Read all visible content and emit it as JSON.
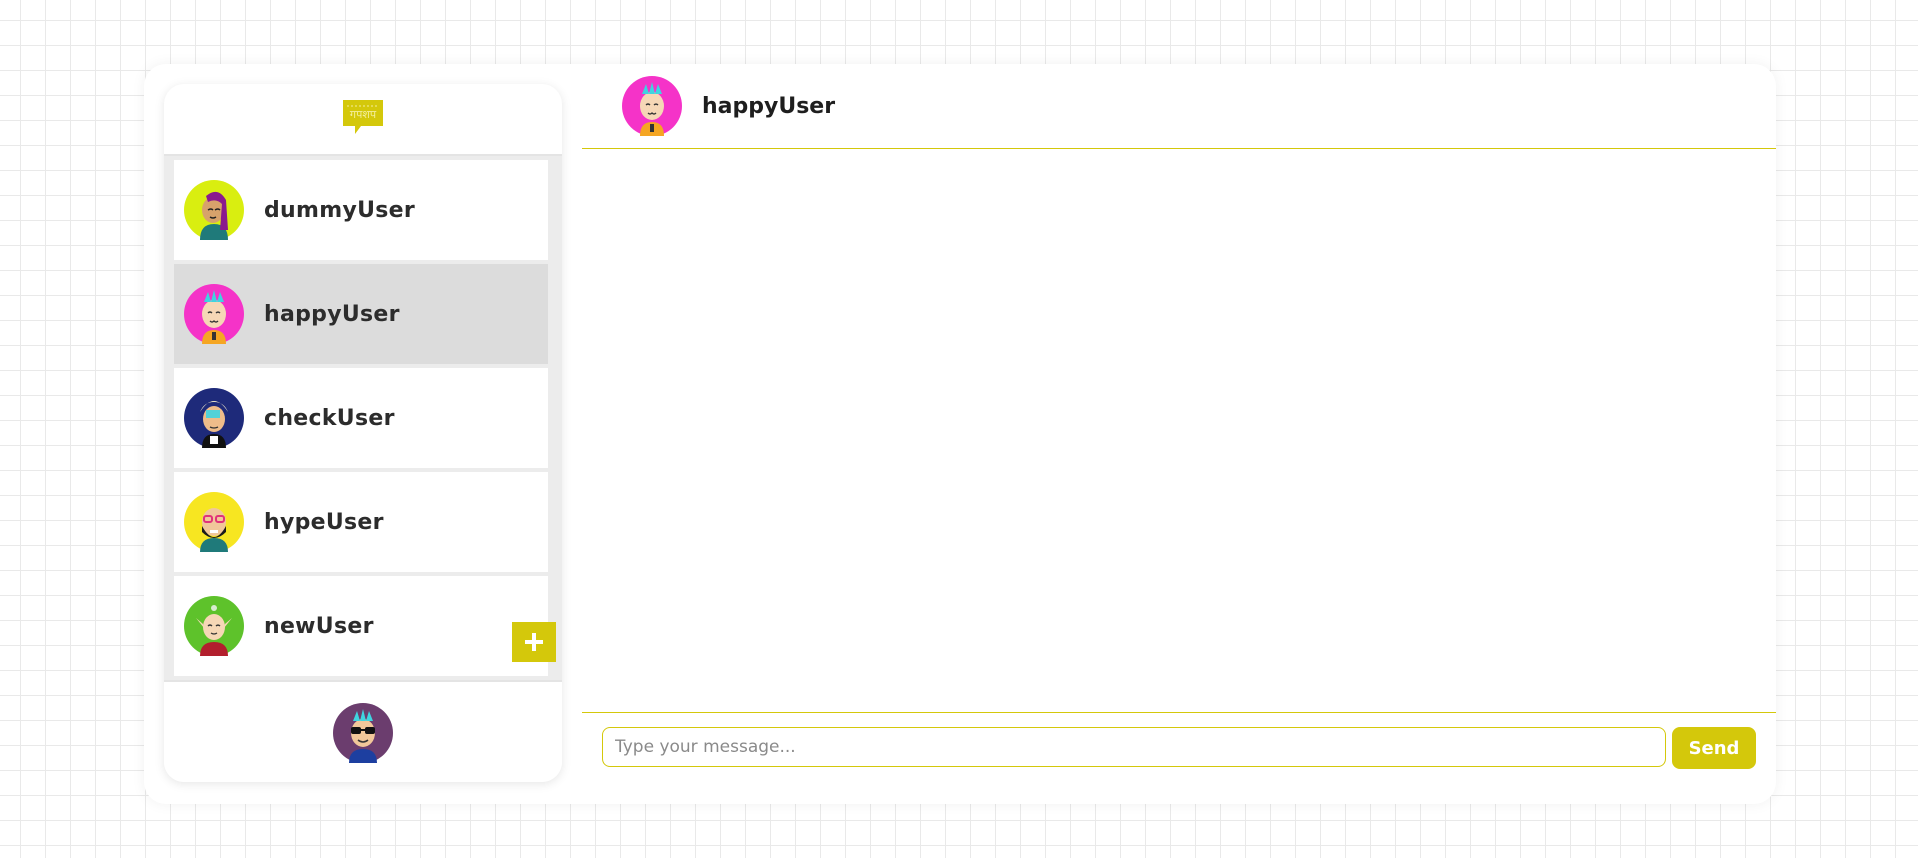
{
  "app": {
    "logo_icon": "chat-bubble-logo-icon",
    "accent_color": "#d4c80b"
  },
  "sidebar": {
    "users": [
      {
        "name": "dummyUser",
        "avatar_bg": "#d9ee10",
        "avatar_icon": "woman-avatar-icon",
        "active": false
      },
      {
        "name": "happyUser",
        "avatar_bg": "#f533c8",
        "avatar_icon": "smiling-punk-avatar-icon",
        "active": true
      },
      {
        "name": "checkUser",
        "avatar_bg": "#1e2a7a",
        "avatar_icon": "dreadlocks-avatar-icon",
        "active": false
      },
      {
        "name": "hypeUser",
        "avatar_bg": "#f7e621",
        "avatar_icon": "glasses-beard-avatar-icon",
        "active": false
      },
      {
        "name": "newUser",
        "avatar_bg": "#5ec22b",
        "avatar_icon": "elf-avatar-icon",
        "active": false
      }
    ],
    "add_button_icon": "plus-icon",
    "current_user_avatar_bg": "#6b3d6e",
    "current_user_avatar_icon": "sunglasses-avatar-icon"
  },
  "chat": {
    "title": "happyUser",
    "avatar_bg": "#f533c8",
    "avatar_icon": "smiling-punk-avatar-icon",
    "input_placeholder": "Type your message...",
    "send_label": "Send"
  }
}
